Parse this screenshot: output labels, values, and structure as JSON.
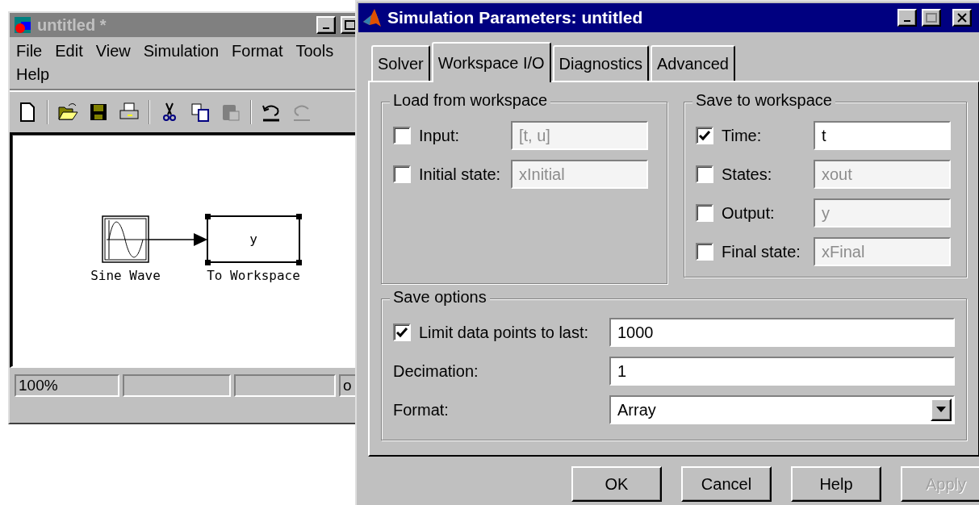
{
  "model_window": {
    "title": "untitled *",
    "active": false,
    "menu": [
      "File",
      "Edit",
      "View",
      "Simulation",
      "Format",
      "Tools",
      "Help"
    ],
    "blocks": [
      {
        "kind": "sine",
        "label": "Sine Wave",
        "selected": false
      },
      {
        "kind": "sink",
        "label": "To Workspace",
        "content": "y",
        "selected": true
      }
    ],
    "status_bar": [
      {
        "kind": "text",
        "text": "100%"
      },
      {
        "kind": "blank"
      },
      {
        "kind": "blank"
      },
      {
        "kind": "text",
        "text": "o"
      }
    ]
  },
  "dialog": {
    "title": "Simulation Parameters: untitled",
    "active": true,
    "tabs": [
      {
        "label": "Solver",
        "selected": false
      },
      {
        "label": "Workspace I/O",
        "selected": true
      },
      {
        "label": "Diagnostics",
        "selected": false
      },
      {
        "label": "Advanced",
        "selected": false
      }
    ],
    "load_from_workspace": {
      "title": "Load from workspace",
      "rows": [
        {
          "label": "Input:",
          "checked": false,
          "value": "[t, u]",
          "disabled": true
        },
        {
          "label": "Initial state:",
          "checked": false,
          "value": "xInitial",
          "disabled": true
        }
      ]
    },
    "save_to_workspace": {
      "title": "Save to workspace",
      "rows": [
        {
          "label": "Time:",
          "checked": true,
          "value": "t",
          "disabled": false
        },
        {
          "label": "States:",
          "checked": false,
          "value": "xout",
          "disabled": true
        },
        {
          "label": "Output:",
          "checked": false,
          "value": "y",
          "disabled": true
        },
        {
          "label": "Final state:",
          "checked": false,
          "value": "xFinal",
          "disabled": true
        }
      ]
    },
    "save_options": {
      "title": "Save options",
      "rows": [
        {
          "kind": "checkbox",
          "label": "Limit data points to last:",
          "checked": true,
          "value": "1000"
        },
        {
          "kind": "text",
          "label": "Decimation:",
          "value": "1"
        },
        {
          "kind": "select",
          "label": "Format:",
          "value": "Array"
        }
      ]
    },
    "buttons": [
      {
        "label": "OK",
        "disabled": false
      },
      {
        "label": "Cancel",
        "disabled": false
      },
      {
        "label": "Help",
        "disabled": false
      },
      {
        "label": "Apply",
        "disabled": true
      }
    ]
  }
}
